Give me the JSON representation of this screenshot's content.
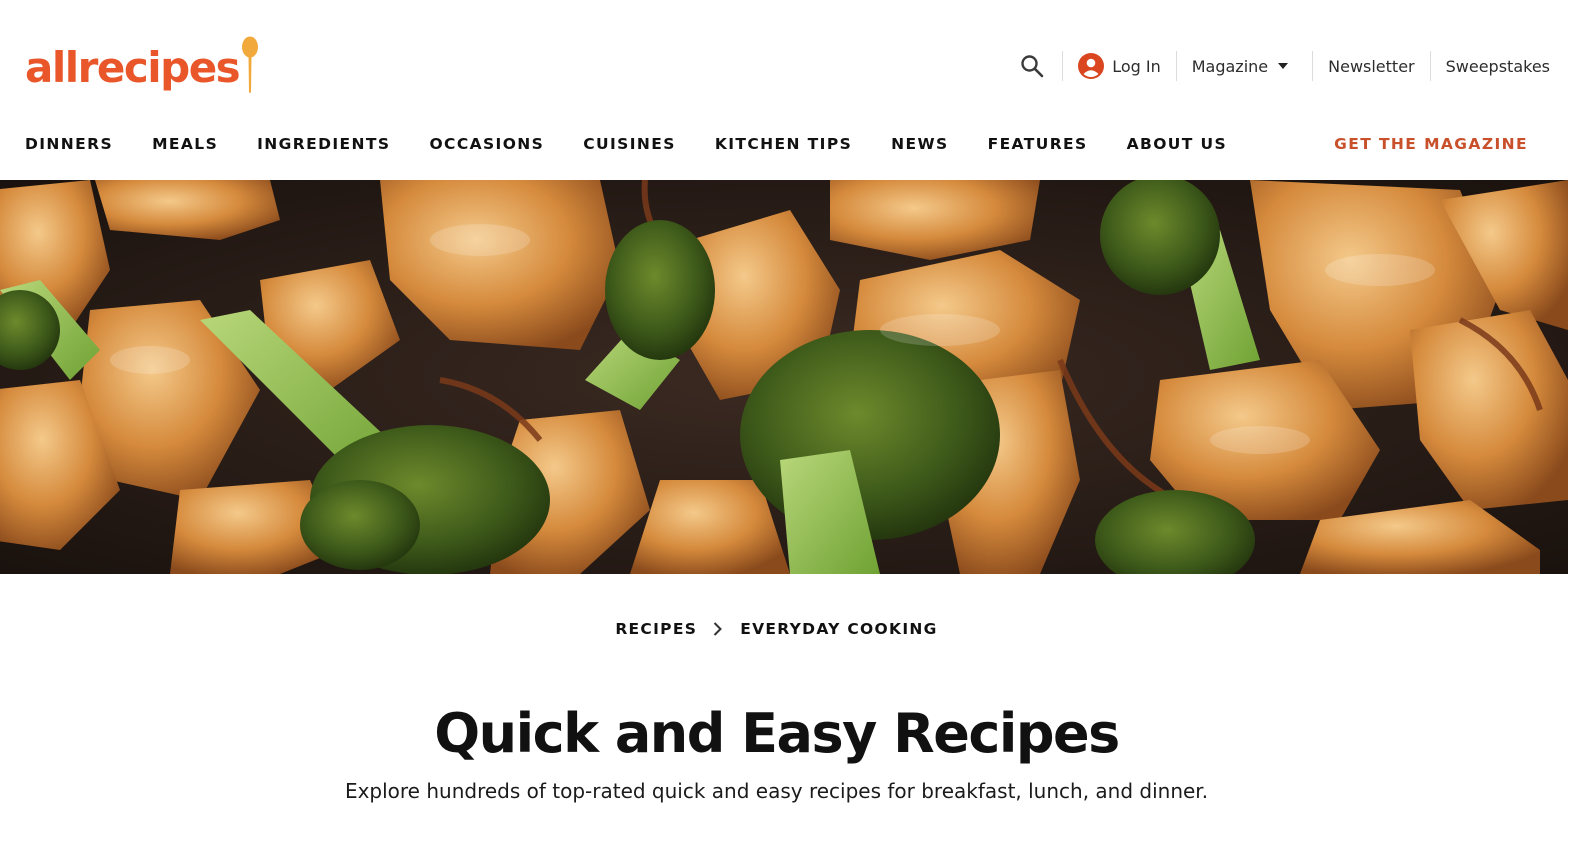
{
  "brand": {
    "logo_text": "allrecipes",
    "colors": {
      "brand_orange": "#e8562a",
      "spoon_yellow": "#f2a93b",
      "cta_orange": "#c8502a",
      "text_dark": "#111111"
    }
  },
  "utility": {
    "search_icon": "search-icon",
    "login_icon": "user-circle-icon",
    "login_label": "Log In",
    "magazine_label": "Magazine",
    "magazine_icon": "caret-down-icon",
    "newsletter_label": "Newsletter",
    "sweepstakes_label": "Sweepstakes"
  },
  "nav": {
    "items": [
      {
        "label": "DINNERS"
      },
      {
        "label": "MEALS"
      },
      {
        "label": "INGREDIENTS"
      },
      {
        "label": "OCCASIONS"
      },
      {
        "label": "CUISINES"
      },
      {
        "label": "KITCHEN TIPS"
      },
      {
        "label": "NEWS"
      },
      {
        "label": "FEATURES"
      },
      {
        "label": "ABOUT US"
      }
    ],
    "cta_label": "GET THE MAGAZINE"
  },
  "hero": {
    "image": "chicken-and-broccoli-stir-fry-photo"
  },
  "breadcrumb": {
    "items": [
      {
        "label": "RECIPES"
      },
      {
        "label": "EVERYDAY COOKING"
      }
    ],
    "separator_icon": "chevron-right-icon"
  },
  "main": {
    "title": "Quick and Easy Recipes",
    "subtitle": "Explore hundreds of top-rated quick and easy recipes for breakfast, lunch, and dinner."
  }
}
